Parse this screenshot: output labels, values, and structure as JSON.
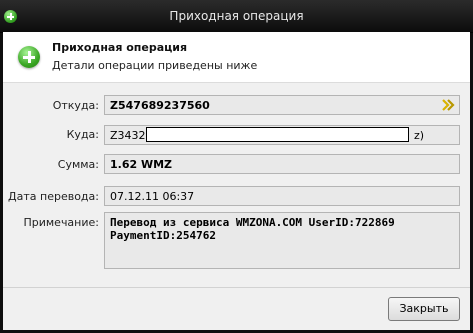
{
  "window": {
    "title": "Приходная операция",
    "title_icon": "green-plus-icon"
  },
  "header": {
    "title": "Приходная операция",
    "subtitle": "Детали операции приведены ниже",
    "icon": "green-plus-icon"
  },
  "fields": {
    "from": {
      "label": "Откуда:",
      "value": "Z547689237560",
      "action_icon": "double-chevron-right-icon"
    },
    "to": {
      "label": "Куда:",
      "value_prefix": "Z34325",
      "value_suffix": "z)"
    },
    "amount": {
      "label": "Сумма:",
      "value": "1.62 WMZ"
    },
    "date": {
      "label": "Дата перевода:",
      "value": "07.12.11 06:37"
    },
    "note": {
      "label": "Примечание:",
      "value": "Перевод из сервиса WMZONA.COM UserID:722869 PaymentID:254762"
    }
  },
  "buttons": {
    "close": "Закрыть"
  },
  "colors": {
    "accent_green": "#3aa624",
    "arrow_yellow": "#d9b300",
    "titlebar": "#151515"
  }
}
